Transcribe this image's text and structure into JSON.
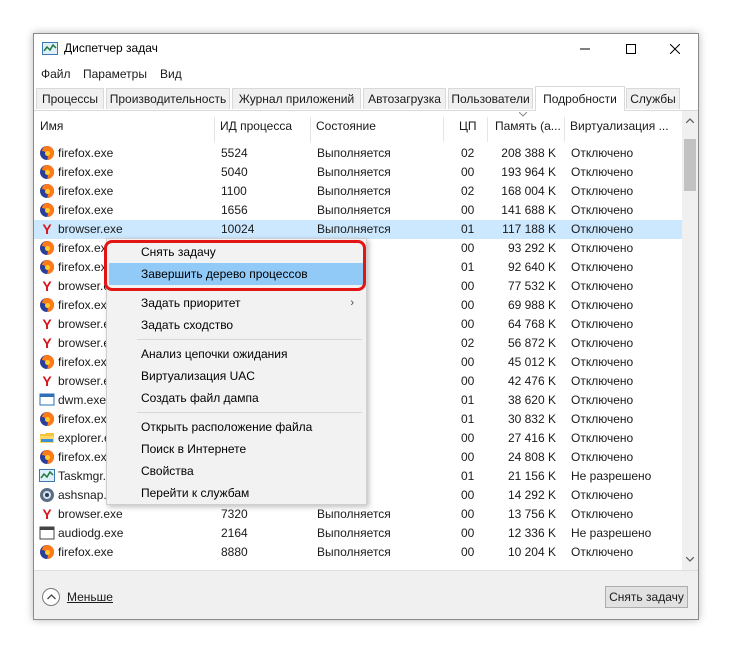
{
  "window": {
    "title": "Диспетчер задач"
  },
  "menu": [
    "Файл",
    "Параметры",
    "Вид"
  ],
  "tabs": [
    {
      "label": "Процессы"
    },
    {
      "label": "Производительность"
    },
    {
      "label": "Журнал приложений"
    },
    {
      "label": "Автозагрузка"
    },
    {
      "label": "Пользователи"
    },
    {
      "label": "Подробности"
    },
    {
      "label": "Службы"
    }
  ],
  "active_tab": "Подробности",
  "columns": {
    "name": "Имя",
    "pid": "ИД процесса",
    "status": "Состояние",
    "cpu": "ЦП",
    "memory": "Память (а...",
    "virt": "Виртуализация ..."
  },
  "rows": [
    {
      "icon": "firefox-icon",
      "name": "firefox.exe",
      "pid": "5524",
      "status": "Выполняется",
      "cpu": "02",
      "memory": "208 388 K",
      "virt": "Отключено"
    },
    {
      "icon": "firefox-icon",
      "name": "firefox.exe",
      "pid": "5040",
      "status": "Выполняется",
      "cpu": "00",
      "memory": "193 964 K",
      "virt": "Отключено"
    },
    {
      "icon": "firefox-icon",
      "name": "firefox.exe",
      "pid": "1100",
      "status": "Выполняется",
      "cpu": "02",
      "memory": "168 004 K",
      "virt": "Отключено"
    },
    {
      "icon": "firefox-icon",
      "name": "firefox.exe",
      "pid": "1656",
      "status": "Выполняется",
      "cpu": "00",
      "memory": "141 688 K",
      "virt": "Отключено"
    },
    {
      "icon": "yandex-icon",
      "name": "browser.exe",
      "pid": "10024",
      "status": "Выполняется",
      "cpu": "01",
      "memory": "117 188 K",
      "virt": "Отключено",
      "selected": true
    },
    {
      "icon": "firefox-icon",
      "name": "firefox.exe",
      "pid": "",
      "status": "",
      "cpu": "00",
      "memory": "93 292 K",
      "virt": "Отключено"
    },
    {
      "icon": "firefox-icon",
      "name": "firefox.exe",
      "pid": "",
      "status": "",
      "cpu": "01",
      "memory": "92 640 K",
      "virt": "Отключено"
    },
    {
      "icon": "yandex-icon",
      "name": "browser.exe",
      "pid": "",
      "status": "",
      "cpu": "00",
      "memory": "77 532 K",
      "virt": "Отключено"
    },
    {
      "icon": "firefox-icon",
      "name": "firefox.exe",
      "pid": "",
      "status": "",
      "cpu": "00",
      "memory": "69 988 K",
      "virt": "Отключено"
    },
    {
      "icon": "yandex-icon",
      "name": "browser.exe",
      "pid": "",
      "status": "",
      "cpu": "00",
      "memory": "64 768 K",
      "virt": "Отключено"
    },
    {
      "icon": "yandex-icon",
      "name": "browser.exe",
      "pid": "",
      "status": "",
      "cpu": "02",
      "memory": "56 872 K",
      "virt": "Отключено"
    },
    {
      "icon": "firefox-icon",
      "name": "firefox.exe",
      "pid": "",
      "status": "",
      "cpu": "00",
      "memory": "45 012 K",
      "virt": "Отключено"
    },
    {
      "icon": "yandex-icon",
      "name": "browser.exe",
      "pid": "",
      "status": "",
      "cpu": "00",
      "memory": "42 476 K",
      "virt": "Отключено"
    },
    {
      "icon": "dwm-icon",
      "name": "dwm.exe",
      "pid": "",
      "status": "",
      "cpu": "01",
      "memory": "38 620 K",
      "virt": "Отключено"
    },
    {
      "icon": "firefox-icon",
      "name": "firefox.exe",
      "pid": "",
      "status": "",
      "cpu": "01",
      "memory": "30 832 K",
      "virt": "Отключено"
    },
    {
      "icon": "explorer-icon",
      "name": "explorer.exe",
      "pid": "",
      "status": "",
      "cpu": "00",
      "memory": "27 416 K",
      "virt": "Отключено"
    },
    {
      "icon": "firefox-icon",
      "name": "firefox.exe",
      "pid": "",
      "status": "",
      "cpu": "00",
      "memory": "24 808 K",
      "virt": "Отключено"
    },
    {
      "icon": "taskmgr-icon",
      "name": "Taskmgr.exe",
      "pid": "",
      "status": "",
      "cpu": "01",
      "memory": "21 156 K",
      "virt": "Не разрешено"
    },
    {
      "icon": "ashsnap-icon",
      "name": "ashsnap.exe",
      "pid": "",
      "status": "",
      "cpu": "00",
      "memory": "14 292 K",
      "virt": "Отключено"
    },
    {
      "icon": "yandex-icon",
      "name": "browser.exe",
      "pid": "7320",
      "status": "Выполняется",
      "cpu": "00",
      "memory": "13 756 K",
      "virt": "Отключено"
    },
    {
      "icon": "audiodg-icon",
      "name": "audiodg.exe",
      "pid": "2164",
      "status": "Выполняется",
      "cpu": "00",
      "memory": "12 336 K",
      "virt": "Не разрешено"
    },
    {
      "icon": "firefox-icon",
      "name": "firefox.exe",
      "pid": "8880",
      "status": "Выполняется",
      "cpu": "00",
      "memory": "10 204 K",
      "virt": "Отключено"
    }
  ],
  "context_menu": {
    "items": [
      {
        "label": "Снять задачу"
      },
      {
        "label": "Завершить дерево процессов",
        "highlighted": true
      },
      {
        "separator": true
      },
      {
        "label": "Задать приоритет",
        "submenu": true
      },
      {
        "label": "Задать сходство"
      },
      {
        "separator": true
      },
      {
        "label": "Анализ цепочки ожидания"
      },
      {
        "label": "Виртуализация UAC"
      },
      {
        "label": "Создать файл дампа"
      },
      {
        "separator": true
      },
      {
        "label": "Открыть расположение файла"
      },
      {
        "label": "Поиск в Интернете"
      },
      {
        "label": "Свойства"
      },
      {
        "label": "Перейти к службам"
      }
    ]
  },
  "footer": {
    "less_label": "Меньше",
    "end_task_label": "Снять задачу"
  },
  "colors": {
    "selection": "#cce8ff",
    "menu_highlight": "#91c9f7",
    "red_marker": "#e31414"
  }
}
